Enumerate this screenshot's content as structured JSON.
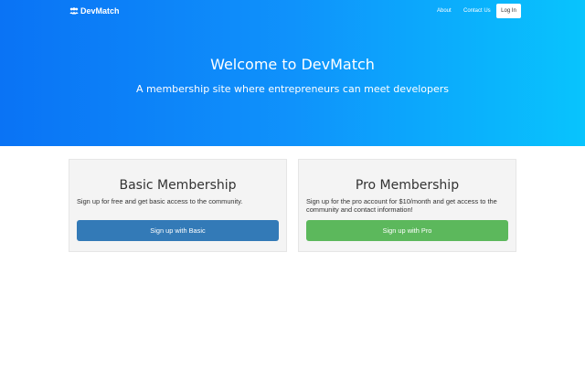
{
  "nav": {
    "brand": "DevMatch",
    "brand_icon": "users-icon",
    "about": "About",
    "contact": "Contact Us",
    "login": "Log In"
  },
  "hero": {
    "title": "Welcome to DevMatch",
    "subtitle": "A membership site where entrepreneurs can meet developers"
  },
  "plans": {
    "basic": {
      "title": "Basic Membership",
      "description": "Sign up for free and get basic access to the community.",
      "button": "Sign up with Basic"
    },
    "pro": {
      "title": "Pro Membership",
      "description": "Sign up for the pro account for $10/month and get access to the community and contact information!",
      "button": "Sign up with Pro"
    }
  },
  "colors": {
    "hero_start": "#0a73f5",
    "hero_end": "#08c4fd",
    "basic_button": "#337ab7",
    "pro_button": "#5cb85c"
  }
}
